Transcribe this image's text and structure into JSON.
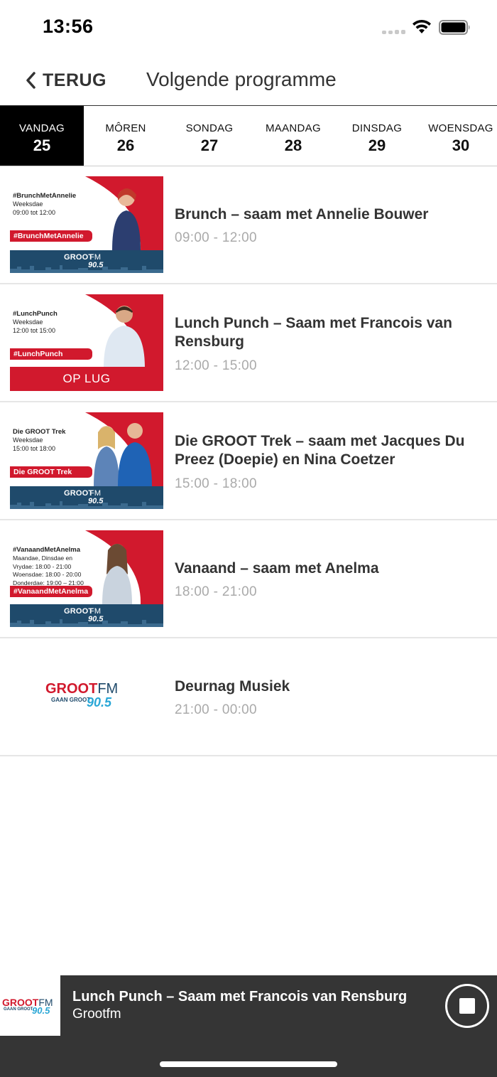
{
  "status_bar": {
    "time": "13:56"
  },
  "nav": {
    "back_label": "TERUG",
    "title": "Volgende programme"
  },
  "tabs": [
    {
      "day": "VANDAG",
      "date": "25",
      "active": true
    },
    {
      "day": "MÔREN",
      "date": "26",
      "active": false
    },
    {
      "day": "SONDAG",
      "date": "27",
      "active": false
    },
    {
      "day": "MAANDAG",
      "date": "28",
      "active": false
    },
    {
      "day": "DINSDAG",
      "date": "29",
      "active": false
    },
    {
      "day": "WOENSDAG",
      "date": "30",
      "active": false
    }
  ],
  "programs": [
    {
      "title": "Brunch – saam met Annelie Bouwer",
      "time": "09:00 - 12:00",
      "thumb": {
        "handle": "#BrunchMetAnnelie",
        "schedule": "Weeksdae\n09:00 tot 12:00",
        "tag": "#BrunchMetAnnelie"
      }
    },
    {
      "title": "Lunch Punch – Saam met Francois van Rensburg",
      "time": "12:00 - 15:00",
      "thumb": {
        "handle": "#LunchPunch",
        "schedule": "Weeksdae\n12:00 tot 15:00",
        "tag": "#LunchPunch",
        "live_label": "OP LUG"
      }
    },
    {
      "title": "Die GROOT Trek – saam met Jacques Du Preez (Doepie) en Nina Coetzer",
      "time": "15:00 - 18:00",
      "thumb": {
        "handle": "Die GROOT Trek",
        "schedule": "Weeksdae\n15:00 tot 18:00",
        "tag": "Die GROOT Trek"
      }
    },
    {
      "title": "Vanaand – saam met Anelma",
      "time": "18:00 - 21:00",
      "thumb": {
        "handle": "#VanaandMetAnelma",
        "schedule": "Maandae, Dinsdae en\nVrydae: 18:00 - 21:00\nWoensdae: 18:00 - 20:00\nDonderdae: 19:00 – 21:00",
        "tag": "#VanaandMetAnelma"
      }
    },
    {
      "title": "Deurnag Musiek",
      "time": "21:00 - 00:00"
    }
  ],
  "brand": {
    "groot": "GROOT",
    "fm": "FM",
    "tagline": "GAAN GROOT",
    "freq": "90.5"
  },
  "player": {
    "title": "Lunch Punch – Saam met Francois van Rensburg",
    "subtitle": "Grootfm"
  },
  "colors": {
    "accent_red": "#d1192d",
    "navy": "#1f4a6b",
    "player_bg": "#353535",
    "active_tab": "#000000"
  }
}
